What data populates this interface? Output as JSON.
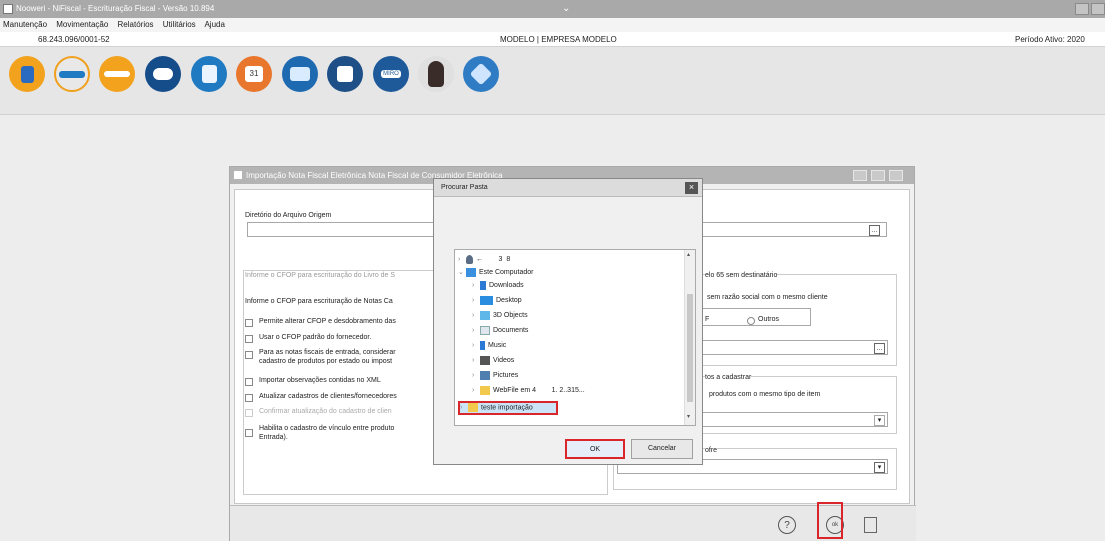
{
  "window": {
    "title": "Nooweri - NiFiscal - Escrituração Fiscal - Versão 10.894"
  },
  "menubar": [
    "Manutenção",
    "Movimentação",
    "Relatórios",
    "Utilitários",
    "Ajuda"
  ],
  "infobar": {
    "cnpj": "68.243.096/0001-52",
    "empresa": "MODELO | EMPRESA MODELO",
    "periodo": "Período Ativo: 2020"
  },
  "toolbar": {
    "icons": [
      "building-icon",
      "sped-icon",
      "sintegra-icon",
      "cloud-sync-icon",
      "documents-icon",
      "calendar-icon",
      "chat-icon",
      "settings-doc-icon",
      "mirror-icon",
      "assistant-avatar-icon",
      "help-arrow-icon"
    ],
    "mirror_label": "MIRO",
    "calendar_label": "31"
  },
  "import_window": {
    "title": "Importação Nota Fiscal Eletrônica Nota Fiscal de Consumidor Eletrônica",
    "dir_label": "Diretório do Arquivo Origem",
    "group1_title": "Informe o CFOP para escrituração do Livro de S",
    "cfop_label": "Informe o CFOP para escrituração de Notas Ca",
    "checkboxes": [
      "Permite alterar CFOP e desdobramento das",
      "Usar o CFOP padrão do fornecedor.",
      "Para as notas fiscais de entrada, considerar",
      "cadastro de produtos por estado ou impost",
      "Importar observações contidas no XML",
      "Atualizar cadastros de clientes/fornecedores",
      "Confirmar atualização do cadastro de clien",
      "Habilita o cadastro de vínculo entre produto",
      "Entrada)."
    ],
    "right_group_title": "elo 65 sem destinatário",
    "right_text": "sem razão social com o mesmo cliente",
    "radio_partial": "F",
    "radio_outros": "Outros",
    "group3_title": "tos a cadastrar",
    "group3_text": "produtos com o mesmo tipo de item",
    "group4_title": "ofre",
    "footer_ok": "ok"
  },
  "folder_dialog": {
    "title": "Procurar Pasta",
    "tree": [
      {
        "label": "←        3  8",
        "icon": "user-folder-icon",
        "expanded": false,
        "level": 0
      },
      {
        "label": "Este Computador",
        "icon": "computer-icon",
        "expanded": true,
        "level": 0
      },
      {
        "label": "Downloads",
        "icon": "downloads-icon",
        "expanded": false,
        "level": 1
      },
      {
        "label": "Desktop",
        "icon": "desktop-icon",
        "expanded": false,
        "level": 1
      },
      {
        "label": "3D Objects",
        "icon": "3d-objects-icon",
        "expanded": false,
        "level": 1
      },
      {
        "label": "Documents",
        "icon": "documents-icon",
        "expanded": false,
        "level": 1
      },
      {
        "label": "Music",
        "icon": "music-icon",
        "expanded": false,
        "level": 1
      },
      {
        "label": "Videos",
        "icon": "videos-icon",
        "expanded": false,
        "level": 1
      },
      {
        "label": "Pictures",
        "icon": "pictures-icon",
        "expanded": false,
        "level": 1
      },
      {
        "label": "WebFile em 4        1. 2..315...",
        "icon": "network-folder-icon",
        "expanded": false,
        "level": 1
      },
      {
        "label": "teste importação",
        "icon": "folder-icon",
        "expanded": false,
        "level": 0,
        "selected": true
      }
    ],
    "ok_label": "OK",
    "cancel_label": "Cancelar"
  },
  "colors": {
    "highlight": "#d9262b",
    "selection": "#cce4f7"
  }
}
